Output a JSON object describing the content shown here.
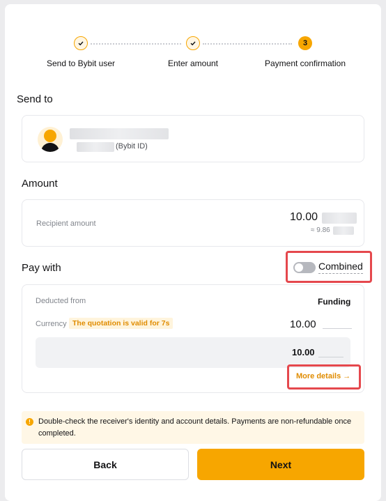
{
  "stepper": {
    "steps": [
      {
        "label": "Send to Bybit user",
        "state": "done"
      },
      {
        "label": "Enter amount",
        "state": "done"
      },
      {
        "label": "Payment confirmation",
        "state": "active",
        "number": "3"
      }
    ]
  },
  "send_to": {
    "title": "Send to",
    "suffix": "(Bybit ID)"
  },
  "amount": {
    "title": "Amount",
    "recipient_label": "Recipient amount",
    "value": "10.00",
    "approx": "≈ 9.86"
  },
  "pay_with": {
    "title": "Pay with",
    "toggle_label": "Combined",
    "toggle_on": false,
    "deducted_label": "Deducted from",
    "deducted_value": "Funding",
    "currency_label": "Currency",
    "quote_badge": "The quotation is valid for 7s",
    "currency_value": "10.00",
    "box_value": "10.00",
    "more_details": "More details →"
  },
  "notice": {
    "text": "Double-check the receiver's identity and account details. Payments are non-refundable once completed."
  },
  "buttons": {
    "back": "Back",
    "next": "Next"
  },
  "colors": {
    "accent": "#f7a600",
    "highlight_border": "#e5484d",
    "notice_bg": "#fff7e6"
  }
}
